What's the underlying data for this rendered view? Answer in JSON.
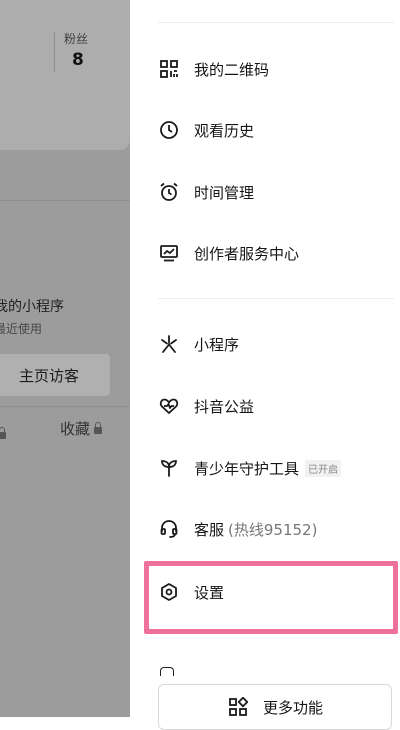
{
  "background_page": {
    "fans_label": "粉丝",
    "fans_count": "8",
    "mini_program_title": "我的小程序",
    "mini_program_subtitle": "最近使用",
    "visitor_button": "主页访客",
    "favorites": "收藏"
  },
  "menu": {
    "items": [
      {
        "label": "我的二维码",
        "icon": "qr-code-icon"
      },
      {
        "label": "观看历史",
        "icon": "clock-icon"
      },
      {
        "label": "时间管理",
        "icon": "alarm-clock-icon"
      },
      {
        "label": "创作者服务中心",
        "icon": "creator-chart-icon"
      },
      {
        "label": "小程序",
        "icon": "mini-program-icon"
      },
      {
        "label": "抖音公益",
        "icon": "heart-wave-icon"
      },
      {
        "label": "青少年守护工具",
        "icon": "sprout-icon",
        "badge": "已开启"
      },
      {
        "label": "客服",
        "suffix": "(热线95152)",
        "icon": "headset-icon"
      },
      {
        "label": "设置",
        "icon": "hexagon-settings-icon"
      }
    ],
    "more_button": "更多功能"
  },
  "colors": {
    "highlight": "#ef6f9d",
    "overlay": "#9c9c9c",
    "panel": "#ffffff"
  }
}
